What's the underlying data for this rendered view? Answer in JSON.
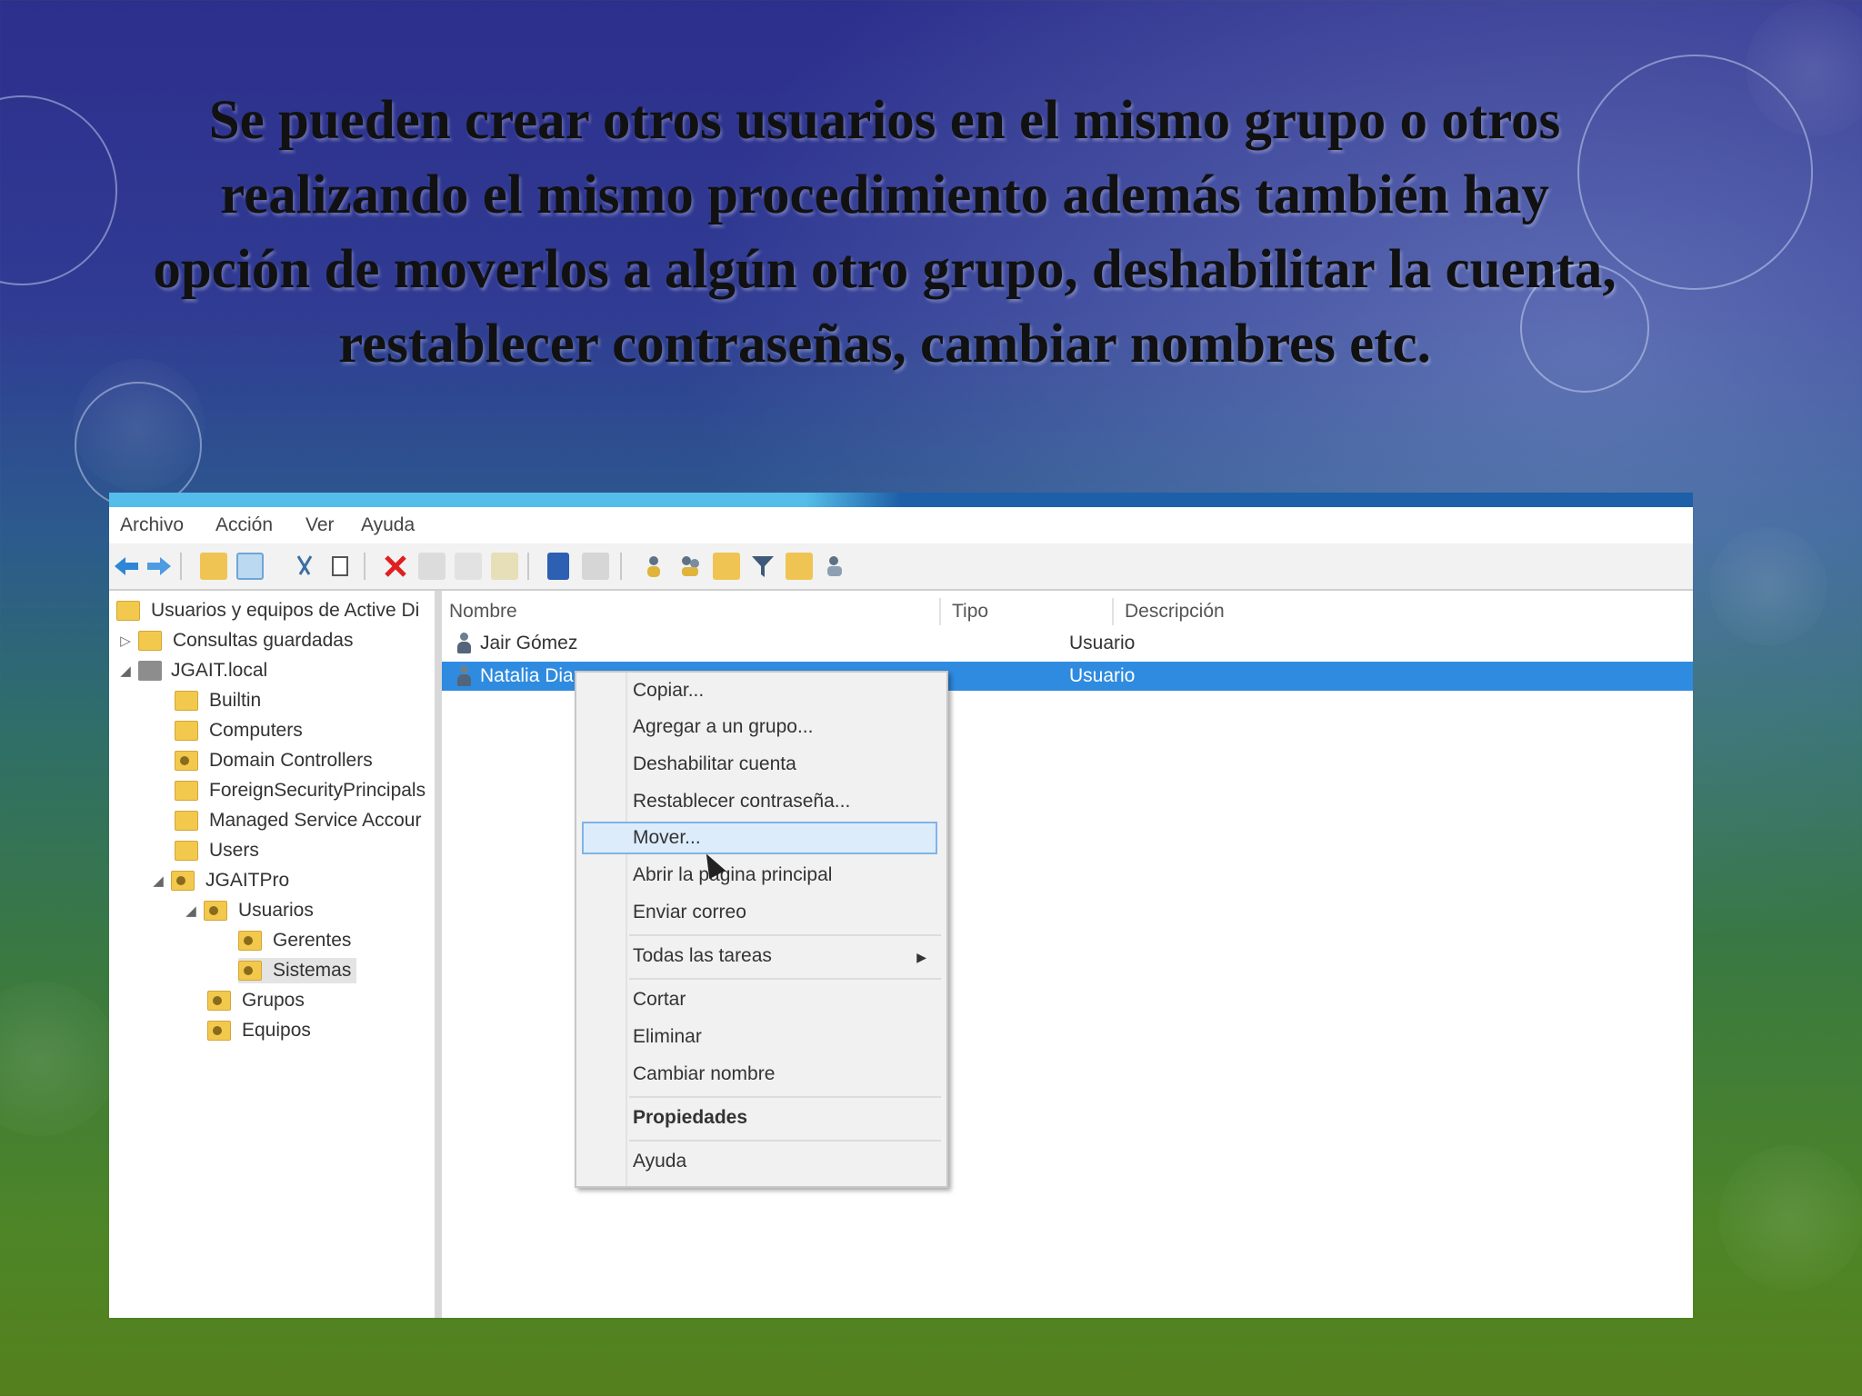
{
  "slide": {
    "headline": "Se pueden crear otros usuarios en el mismo grupo o otros realizando el mismo procedimiento además también hay opción de moverlos a algún otro grupo, deshabilitar la cuenta, restablecer contraseñas, cambiar nombres etc."
  },
  "window": {
    "menu": [
      "Archivo",
      "Acción",
      "Ver",
      "Ayuda"
    ],
    "toolbar_icons": [
      "back-arrow-icon",
      "forward-arrow-icon",
      "up-folder-icon",
      "show-console-tree-icon",
      "cut-icon",
      "copy-icon",
      "delete-icon",
      "properties-icon",
      "refresh-icon",
      "export-list-icon",
      "help-icon",
      "view-icon",
      "new-user-icon",
      "new-group-icon",
      "new-ou-icon",
      "filter-icon",
      "find-icon",
      "add-to-group-icon"
    ],
    "tree": {
      "root": "Usuarios y equipos de Active Di",
      "saved_queries": "Consultas guardadas",
      "domain": "JGAIT.local",
      "builtin": "Builtin",
      "computers": "Computers",
      "domain_controllers": "Domain Controllers",
      "foreign": "ForeignSecurityPrincipals",
      "managed": "Managed Service Accour",
      "users": "Users",
      "ou_root": "JGAITPro",
      "ou_usuarios": "Usuarios",
      "ou_gerentes": "Gerentes",
      "ou_sistemas": "Sistemas",
      "ou_grupos": "Grupos",
      "ou_equipos": "Equipos"
    },
    "columns": {
      "name": "Nombre",
      "type": "Tipo",
      "description": "Descripción"
    },
    "rows": [
      {
        "name": "Jair Gómez",
        "type": "Usuario"
      },
      {
        "name": "Natalia Dia",
        "type": "Usuario"
      }
    ],
    "context_menu": {
      "copy": "Copiar...",
      "add_to_group": "Agregar a un grupo...",
      "disable": "Deshabilitar cuenta",
      "reset_password": "Restablecer contraseña...",
      "move": "Mover...",
      "open_home": "Abrir la página principal",
      "send_mail": "Enviar correo",
      "all_tasks": "Todas las tareas",
      "cut": "Cortar",
      "delete": "Eliminar",
      "rename": "Cambiar nombre",
      "properties": "Propiedades",
      "help": "Ayuda"
    }
  }
}
